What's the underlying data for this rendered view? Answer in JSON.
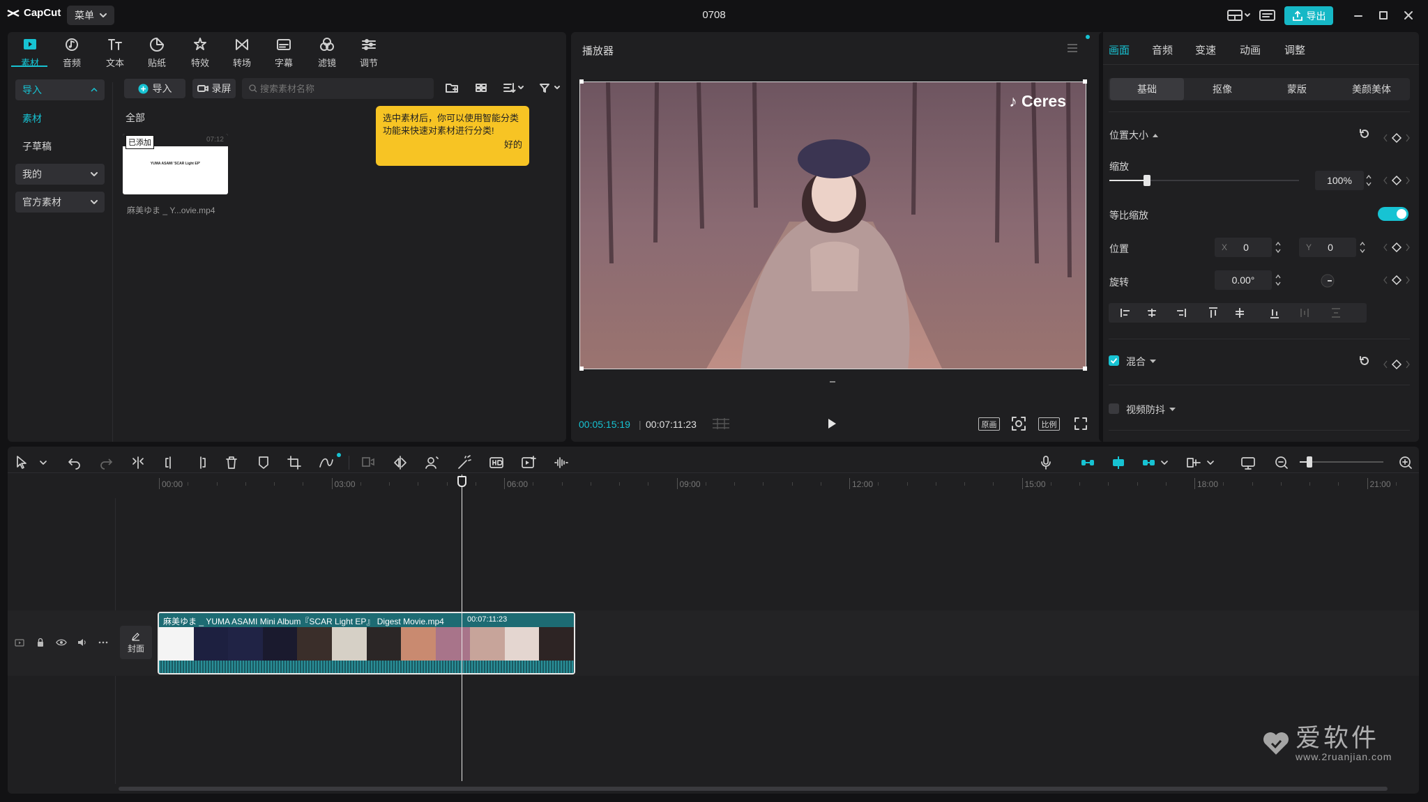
{
  "app": {
    "logo_text": "CapCut",
    "menu_label": "菜单",
    "project_title": "0708",
    "export_label": "导出",
    "accent": "#16b8c6"
  },
  "media_toolbar": [
    {
      "label": "素材",
      "icon": "media-icon",
      "active": true
    },
    {
      "label": "音频",
      "icon": "audio-icon"
    },
    {
      "label": "文本",
      "icon": "text-icon"
    },
    {
      "label": "贴纸",
      "icon": "sticker-icon"
    },
    {
      "label": "特效",
      "icon": "effects-icon"
    },
    {
      "label": "转场",
      "icon": "transition-icon"
    },
    {
      "label": "字幕",
      "icon": "captions-icon"
    },
    {
      "label": "滤镜",
      "icon": "filter-icon"
    },
    {
      "label": "调节",
      "icon": "adjust-icon"
    }
  ],
  "sidebar": {
    "items": [
      {
        "label": "导入",
        "state": "expanded",
        "active": true
      },
      {
        "label": "素材",
        "active": true
      },
      {
        "label": "子草稿"
      },
      {
        "label": "我的"
      },
      {
        "label": "官方素材"
      }
    ]
  },
  "media": {
    "import_label": "导入",
    "record_label": "录屏",
    "search_placeholder": "搜索素材名称",
    "all_label": "全部",
    "added_badge": "已添加",
    "clip_duration": "07:12",
    "clip_name": "麻美ゆま _ Y...ovie.mp4",
    "thumb_text": "YUMA ASAMI 'SCAR Light EP'",
    "tooltip_text": "选中素材后，你可以使用智能分类功能来快速对素材进行分类!",
    "tooltip_ok": "好的"
  },
  "player": {
    "title": "播放器",
    "current_time": "00:05:15:19",
    "total_time": "00:07:11:23",
    "overlay_text": "♪ Ceres",
    "btn_original": "原画",
    "btn_ratio": "比例"
  },
  "inspector": {
    "tabs": [
      "画面",
      "音频",
      "变速",
      "动画",
      "调整"
    ],
    "subtabs": [
      "基础",
      "抠像",
      "蒙版",
      "美颜美体"
    ],
    "pos_size_label": "位置大小",
    "scale_label": "缩放",
    "scale_value": "100%",
    "scale_fraction": 0.2,
    "uniform_label": "等比缩放",
    "uniform_on": true,
    "position_label": "位置",
    "x_label": "X",
    "x_value": "0",
    "y_label": "Y",
    "y_value": "0",
    "rotate_label": "旋转",
    "rotate_value": "0.00°",
    "blend_label": "混合",
    "stabilize_label": "视频防抖"
  },
  "timeline": {
    "ruler": [
      "00:00",
      "03:00",
      "06:00",
      "09:00",
      "12:00",
      "15:00",
      "18:00",
      "21:00"
    ],
    "cover_label": "封面",
    "clip_title": "麻美ゆま _ YUMA ASAMI Mini Album『SCAR Light EP』 Digest Movie.mp4",
    "clip_duration": "00:07:11:23"
  },
  "watermark": {
    "brand": "爱软件",
    "url": "www.2ruanjian.com"
  }
}
